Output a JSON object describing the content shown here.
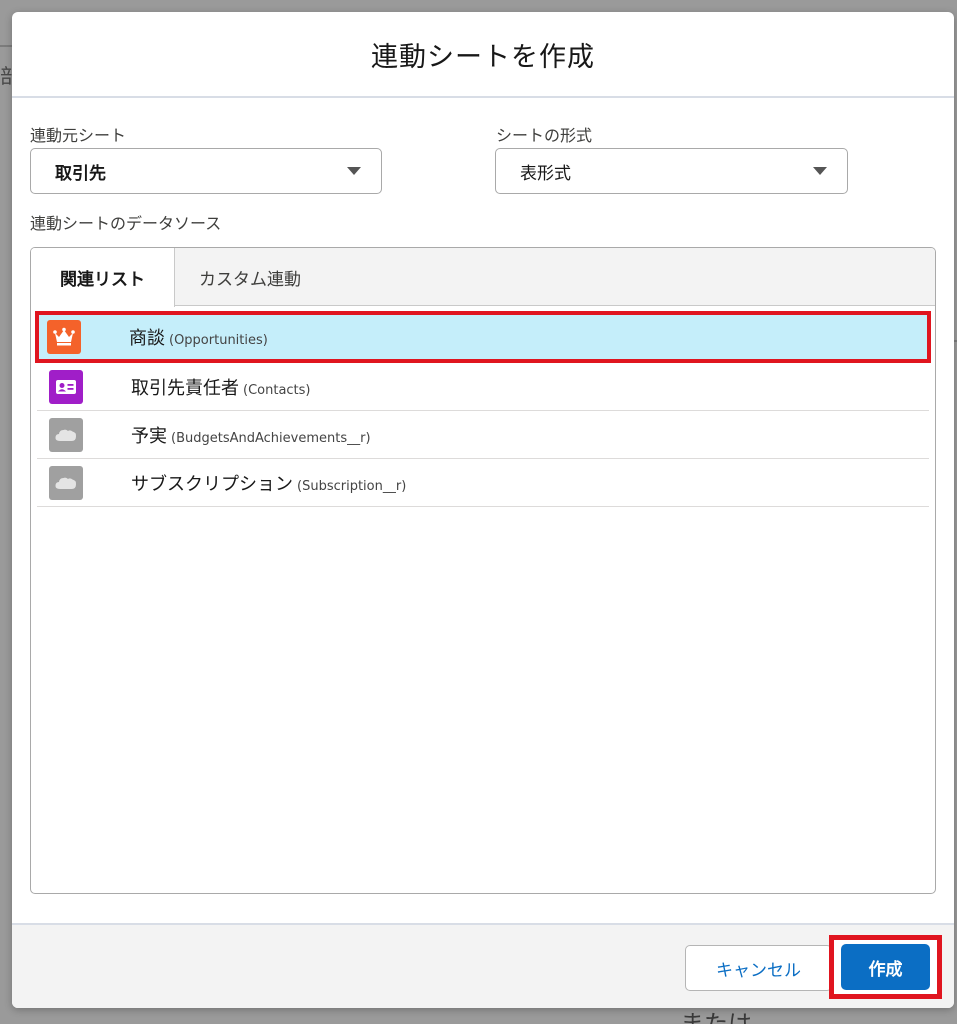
{
  "background": {
    "fragment_text": "部",
    "bottom_text": "または"
  },
  "modal": {
    "title": "連動シートを作成",
    "source_sheet": {
      "label": "連動元シート",
      "value": "取引先"
    },
    "sheet_format": {
      "label": "シートの形式",
      "value": "表形式"
    },
    "data_source_label": "連動シートのデータソース",
    "tabs": [
      {
        "label": "関連リスト",
        "active": true
      },
      {
        "label": "カスタム連動",
        "active": false
      }
    ],
    "related_list": [
      {
        "name": "商談",
        "api": "(Opportunities)",
        "icon": "crown-icon",
        "icon_color": "#f4622a",
        "selected": true
      },
      {
        "name": "取引先責任者",
        "api": "(Contacts)",
        "icon": "contact-card-icon",
        "icon_color": "#a01ec8",
        "selected": false
      },
      {
        "name": "予実",
        "api": "(BudgetsAndAchievements__r)",
        "icon": "cloud-icon",
        "icon_color": "#a0a0a0",
        "selected": false
      },
      {
        "name": "サブスクリプション",
        "api": "(Subscription__r)",
        "icon": "cloud-icon",
        "icon_color": "#a0a0a0",
        "selected": false
      }
    ],
    "footer": {
      "cancel_label": "キャンセル",
      "create_label": "作成"
    }
  },
  "colors": {
    "primary": "#0b6ec4",
    "highlight": "#e0151f",
    "selected_row": "#c5eefa"
  }
}
